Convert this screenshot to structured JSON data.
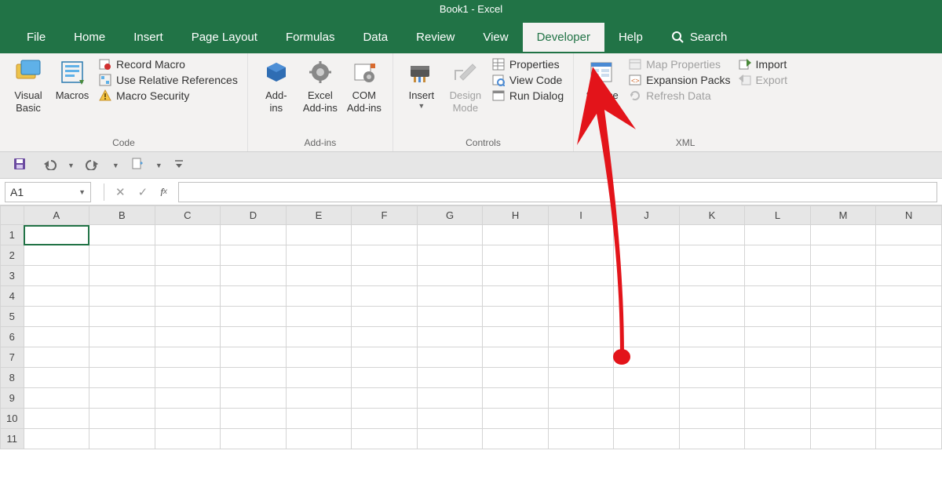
{
  "title": "Book1 - Excel",
  "tabs": [
    "File",
    "Home",
    "Insert",
    "Page Layout",
    "Formulas",
    "Data",
    "Review",
    "View",
    "Developer",
    "Help"
  ],
  "active_tab": "Developer",
  "search_label": "Search",
  "ribbon": {
    "code": {
      "visual_basic": "Visual\nBasic",
      "macros": "Macros",
      "record_macro": "Record Macro",
      "use_relative": "Use Relative References",
      "macro_security": "Macro Security",
      "group_label": "Code"
    },
    "addins": {
      "addins": "Add-\nins",
      "excel_addins": "Excel\nAdd-ins",
      "com_addins": "COM\nAdd-ins",
      "group_label": "Add-ins"
    },
    "controls": {
      "insert": "Insert",
      "design_mode": "Design\nMode",
      "properties": "Properties",
      "view_code": "View Code",
      "run_dialog": "Run Dialog",
      "group_label": "Controls"
    },
    "xml": {
      "source": "Source",
      "map_properties": "Map Properties",
      "expansion_packs": "Expansion Packs",
      "refresh_data": "Refresh Data",
      "import": "Import",
      "export": "Export",
      "group_label": "XML"
    }
  },
  "namebox_value": "A1",
  "columns": [
    "A",
    "B",
    "C",
    "D",
    "E",
    "F",
    "G",
    "H",
    "I",
    "J",
    "K",
    "L",
    "M",
    "N"
  ],
  "rows": [
    "1",
    "2",
    "3",
    "4",
    "5",
    "6",
    "7",
    "8",
    "9",
    "10",
    "11"
  ],
  "selected_cell": "A1"
}
